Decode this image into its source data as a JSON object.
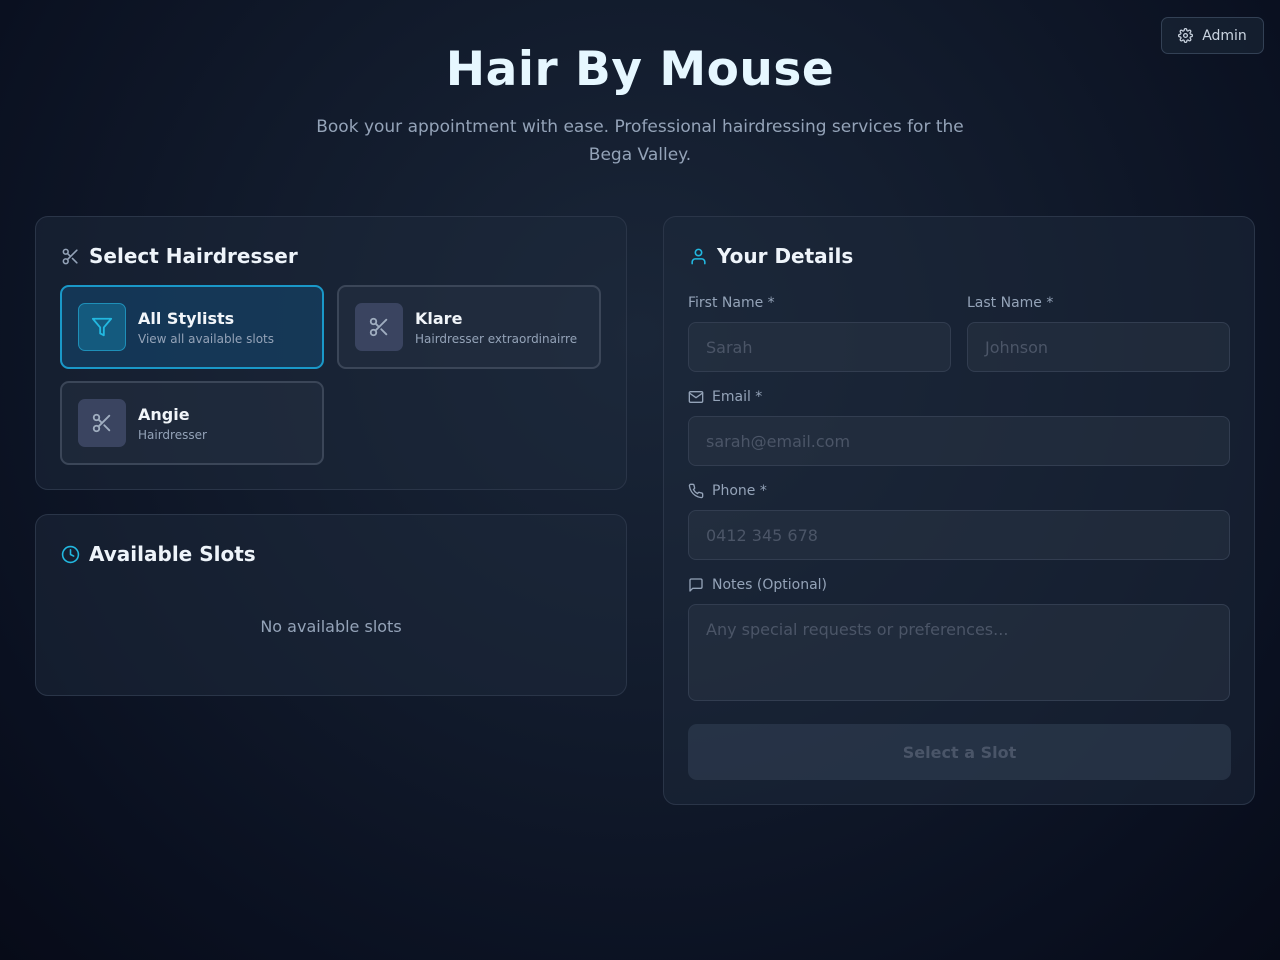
{
  "header": {
    "admin_label": "Admin",
    "title": "Hair By Mouse",
    "subtitle": "Book your appointment with ease. Professional hairdressing services for the Bega Valley."
  },
  "hairdresser_panel": {
    "title": "Select Hairdresser",
    "icon": "scissors-icon",
    "stylists": [
      {
        "name": "All Stylists",
        "description": "View all available slots",
        "icon": "filter-icon",
        "selected": true
      },
      {
        "name": "Klare",
        "description": "Hairdresser extraordinairre",
        "icon": "scissors-icon",
        "selected": false
      },
      {
        "name": "Angie",
        "description": "Hairdresser",
        "icon": "scissors-icon",
        "selected": false
      }
    ]
  },
  "slots_panel": {
    "title": "Available Slots",
    "icon": "clock-icon",
    "empty_text": "No available slots"
  },
  "details_panel": {
    "title": "Your Details",
    "icon": "user-icon",
    "first_name": {
      "label": "First Name *",
      "placeholder": "Sarah"
    },
    "last_name": {
      "label": "Last Name *",
      "placeholder": "Johnson"
    },
    "email": {
      "label": "Email *",
      "placeholder": "sarah@email.com"
    },
    "phone": {
      "label": "Phone *",
      "placeholder": "0412 345 678"
    },
    "notes": {
      "label": "Notes (Optional)",
      "placeholder": "Any special requests or preferences..."
    },
    "submit_label": "Select a Slot"
  },
  "colors": {
    "accent": "#1a98c8",
    "background": "#111a2b",
    "card_border": "#2a3548"
  }
}
